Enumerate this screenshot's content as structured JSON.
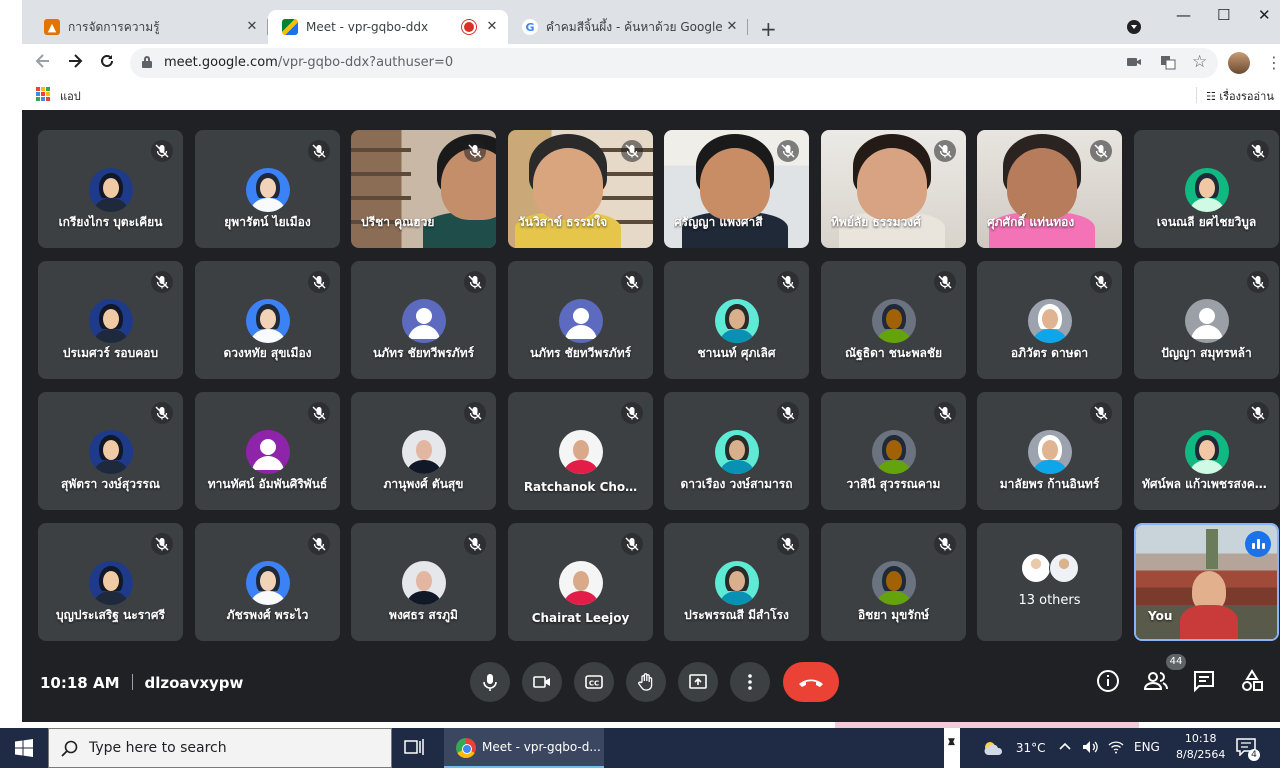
{
  "browser": {
    "tabs": [
      {
        "title": "การจัดการความรู้",
        "favicon": "classroom-icon",
        "state": "inactive"
      },
      {
        "title": "Meet - vpr-gqbo-ddx",
        "favicon": "meet-icon",
        "state": "active",
        "recording": true
      },
      {
        "title": "คำคมสีจิ้นผึ้ง - ค้นหาด้วย Google",
        "favicon": "google-icon",
        "state": "inactive"
      }
    ],
    "close_glyph": "✕",
    "new_tab_glyph": "+",
    "url_host": "meet.google.com",
    "url_path": "/vpr-gqbo-ddx?authuser=0",
    "bookmarks_apps_label": "แอป",
    "reading_list_label": "เรื่องรออ่าน",
    "window_controls": [
      "—",
      "☐",
      "✕"
    ]
  },
  "meet": {
    "tiles": [
      {
        "name": "เกรียงไกร บุตะเคียน",
        "type": "avatar"
      },
      {
        "name": "ยุพารัตน์ ไยเมือง",
        "type": "avatar"
      },
      {
        "name": "ปรีชา คุณฮวย",
        "type": "video"
      },
      {
        "name": "วันวิสาข์ ธรรมใจ",
        "type": "video"
      },
      {
        "name": "ศรัญญา แพงศาสี",
        "type": "video"
      },
      {
        "name": "ทิพย์ลัย ธรรมวงศ์",
        "type": "video"
      },
      {
        "name": "ศุภศักดิ์ แท่นทอง",
        "type": "video"
      },
      {
        "name": "เจนณลี ยศไชยวิบูล",
        "type": "avatar"
      },
      {
        "name": "ปรเมศวร์ รอบคอบ",
        "type": "avatar"
      },
      {
        "name": "ดวงหทัย สุขเมือง",
        "type": "avatar"
      },
      {
        "name": "นภัทร ชัยทวีพรภัทร์",
        "type": "avatar"
      },
      {
        "name": "นภัทร ชัยทวีพรภัทร์",
        "type": "avatar"
      },
      {
        "name": "ชานนท์ ศุภเลิศ",
        "type": "avatar"
      },
      {
        "name": "ณัฐธิดา ชนะพลชัย",
        "type": "avatar"
      },
      {
        "name": "อภิวัตร ดาษดา",
        "type": "avatar"
      },
      {
        "name": "ปัญญา สมุทรหล้า",
        "type": "avatar"
      },
      {
        "name": "สุพัตรา วงษ์สุวรรณ",
        "type": "avatar"
      },
      {
        "name": "ทานทัศน์ อัมพันศิริพันธ์",
        "type": "avatar"
      },
      {
        "name": "ภานุพงศ์ ตันสุข",
        "type": "avatar"
      },
      {
        "name": "Ratchanok Cho…",
        "type": "avatar"
      },
      {
        "name": "ดาวเรือง วงษ์สามารถ",
        "type": "avatar"
      },
      {
        "name": "วาสินี สุวรรณคาม",
        "type": "avatar"
      },
      {
        "name": "มาลัยพร ก้านอินทร์",
        "type": "avatar"
      },
      {
        "name": "ทัศน์พล แก้วเพชรสงคราม",
        "type": "avatar"
      },
      {
        "name": "บุญประเสริฐ นะราศรี",
        "type": "avatar"
      },
      {
        "name": "ภัชรพงศ์ พระไว",
        "type": "avatar"
      },
      {
        "name": "พงศธร สรภูมิ",
        "type": "avatar"
      },
      {
        "name": "Chairat Leejoy",
        "type": "avatar"
      },
      {
        "name": "ประพรรณสี มีสำโรง",
        "type": "avatar"
      },
      {
        "name": "อิชยา มุขรักษ์",
        "type": "avatar"
      }
    ],
    "others_label": "13 others",
    "you_label": "You",
    "time": "10:18 AM",
    "meeting_code": "dlzoavxypw",
    "people_count": "44"
  },
  "taskbar": {
    "search_placeholder": "Type here to search",
    "chrome_task_label": "Meet - vpr-gqbo-d...",
    "weather": "31°C",
    "lang": "ENG",
    "time": "10:18",
    "date": "8/8/2564",
    "notifications": "4",
    "tray_up_label": "▲",
    "tray_down_label": "▼"
  },
  "colors": {
    "meet_bg": "#202124",
    "tile_bg": "#3c4043",
    "leave_red": "#ea4335",
    "accent_blue": "#1a73e8",
    "taskbar": "#1f2a44"
  }
}
